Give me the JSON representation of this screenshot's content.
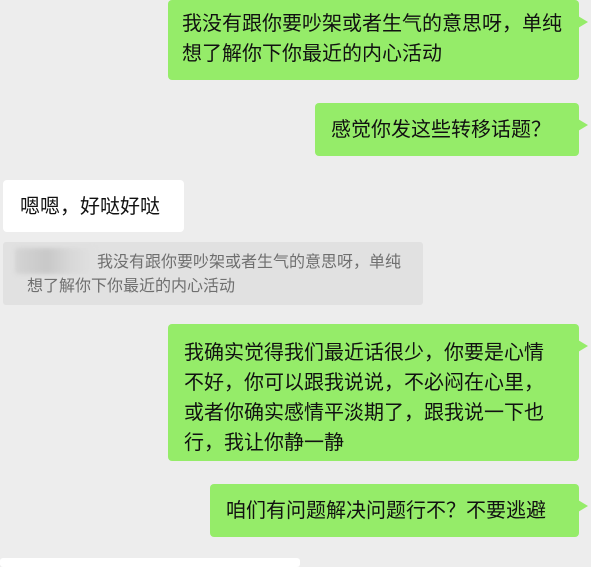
{
  "messages": [
    {
      "id": "m1",
      "side": "me",
      "text": "我没有跟你要吵架或者生气的意思呀，单纯想了解你下你最近的内心活动"
    },
    {
      "id": "m2",
      "side": "me",
      "text": "感觉你发这些转移话题？"
    },
    {
      "id": "m3",
      "side": "other",
      "text": "嗯嗯，好哒好哒"
    },
    {
      "id": "m4",
      "side": "quote",
      "text": "我没有跟你要吵架或者生气的意思呀，单纯想了解你下你最近的内心活动"
    },
    {
      "id": "m5",
      "side": "me",
      "text": "我确实觉得我们最近话很少，你要是心情不好，你可以跟我说说，不必闷在心里，或者你确实感情平淡期了，跟我说一下也行，我让你静一静"
    },
    {
      "id": "m6",
      "side": "me",
      "text": "咱们有问题解决问题行不？不要逃避"
    }
  ],
  "colors": {
    "background": "#ededed",
    "my_bubble": "#95ec69",
    "other_bubble": "#ffffff",
    "quote_bg": "#e1e1e1",
    "quote_text": "#6f6f6f"
  }
}
